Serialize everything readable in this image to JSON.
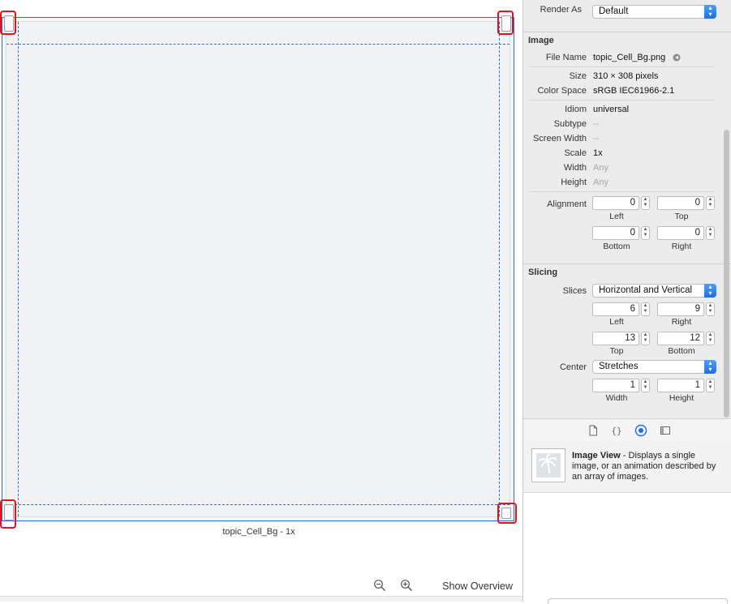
{
  "canvas": {
    "caption": "topic_Cell_Bg - 1x",
    "show_overview_label": "Show Overview",
    "zoom_out_icon": "zoom-out-icon",
    "zoom_in_icon": "zoom-in-icon",
    "highlight_color": "#e0141e",
    "slice_guide_color": "#2f6fb5"
  },
  "inspector": {
    "render_as": {
      "label": "Render As",
      "value": "Default"
    },
    "image_section": {
      "title": "Image",
      "file_name": {
        "label": "File Name",
        "value": "topic_Cell_Bg.png"
      },
      "size": {
        "label": "Size",
        "value": "310 × 308 pixels"
      },
      "color_space": {
        "label": "Color Space",
        "value": "sRGB IEC61966-2.1"
      },
      "idiom": {
        "label": "Idiom",
        "value": "universal"
      },
      "subtype": {
        "label": "Subtype",
        "value": "--"
      },
      "screen_width": {
        "label": "Screen Width",
        "value": "--"
      },
      "scale": {
        "label": "Scale",
        "value": "1x"
      },
      "width": {
        "label": "Width",
        "value": "Any"
      },
      "height": {
        "label": "Height",
        "value": "Any"
      },
      "alignment": {
        "label": "Alignment",
        "left": {
          "value": "0",
          "caption": "Left"
        },
        "top": {
          "value": "0",
          "caption": "Top"
        },
        "bottom": {
          "value": "0",
          "caption": "Bottom"
        },
        "right": {
          "value": "0",
          "caption": "Right"
        }
      }
    },
    "slicing_section": {
      "title": "Slicing",
      "slices": {
        "label": "Slices",
        "value": "Horizontal and Vertical"
      },
      "left": {
        "value": "6",
        "caption": "Left"
      },
      "right": {
        "value": "9",
        "caption": "Right"
      },
      "top": {
        "value": "13",
        "caption": "Top"
      },
      "bottom": {
        "value": "12",
        "caption": "Bottom"
      },
      "center": {
        "label": "Center",
        "value": "Stretches"
      },
      "center_width": {
        "value": "1",
        "caption": "Width"
      },
      "center_height": {
        "value": "1",
        "caption": "Height"
      }
    },
    "tabs": [
      "file-inspector-icon",
      "quick-help-icon",
      "attributes-inspector-icon",
      "size-inspector-icon"
    ],
    "accent_color": "#1c6fe0"
  },
  "library": {
    "item_title": "Image View",
    "item_description": " - Displays a single image, or an animation described by an array of images."
  }
}
